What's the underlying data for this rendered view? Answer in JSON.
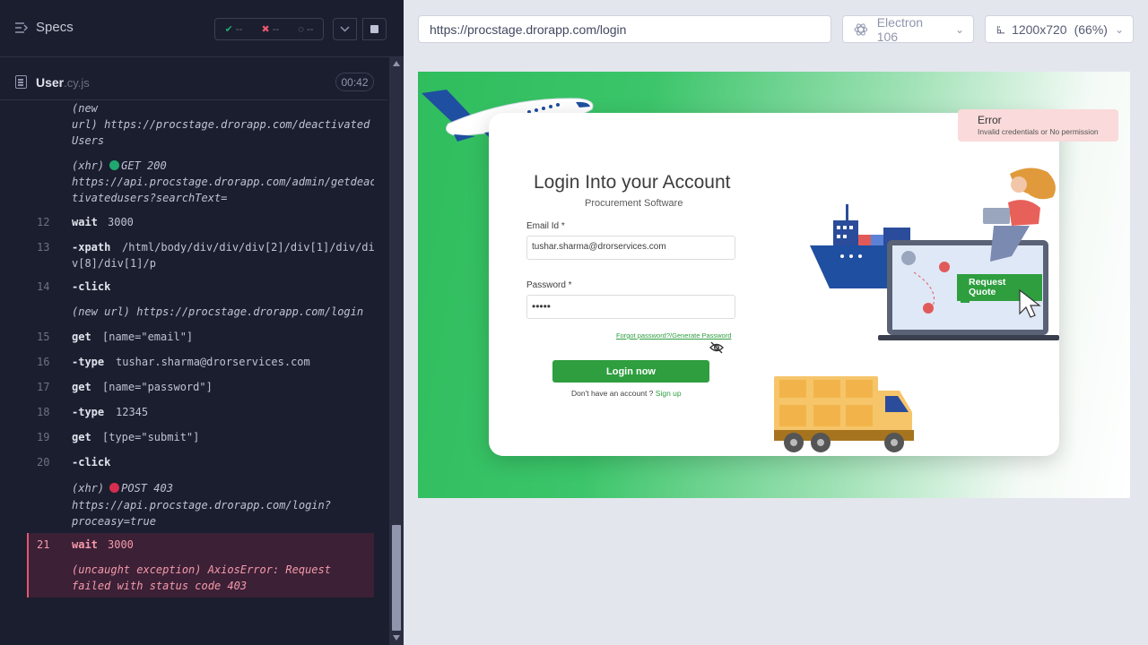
{
  "runner": {
    "specs_label": "Specs",
    "stats": {
      "passed": "--",
      "failed": "--",
      "pending": "--"
    },
    "file": {
      "name": "User",
      "ext": ".cy.js"
    },
    "timer": "00:42"
  },
  "log": {
    "r0a": "(new",
    "r0b": "url)  https://procstage.drorapp.com/deactivated",
    "r0c": "Users",
    "r1_prefix": "(xhr)",
    "r1_status": "GET 200",
    "r1b": "https://api.procstage.drorapp.com/admin/getdeac",
    "r1c": "tivatedusers?searchText=",
    "r12_num": "12",
    "r12_cmd": "wait",
    "r12_arg": "3000",
    "r13_num": "13",
    "r13_cmd": "-xpath",
    "r13_arg": "/html/body/div/div/div[2]/div[1]/div/di",
    "r13_arg2": "v[8]/div[1]/p",
    "r14_num": "14",
    "r14_cmd": "-click",
    "r14b": "(new url)  https://procstage.drorapp.com/login",
    "r15_num": "15",
    "r15_cmd": "get",
    "r15_arg": "[name=\"email\"]",
    "r16_num": "16",
    "r16_cmd": "-type",
    "r16_arg": "tushar.sharma@drorservices.com",
    "r17_num": "17",
    "r17_cmd": "get",
    "r17_arg": "[name=\"password\"]",
    "r18_num": "18",
    "r18_cmd": "-type",
    "r18_arg": "12345",
    "r19_num": "19",
    "r19_cmd": "get",
    "r19_arg": "[type=\"submit\"]",
    "r20_num": "20",
    "r20_cmd": "-click",
    "r20b_prefix": "(xhr)",
    "r20b_status": "POST 403",
    "r20c": "https://api.procstage.drorapp.com/login?",
    "r20d": "proceasy=true",
    "r21_num": "21",
    "r21_cmd": "wait",
    "r21_arg": "3000",
    "r21b": "(uncaught exception)  AxiosError: Request",
    "r21c": "failed with status code 403"
  },
  "toolbar": {
    "url": "https://procstage.drorapp.com/login",
    "browser": "Electron 106",
    "viewport": "1200x720",
    "zoom": "(66%)"
  },
  "app": {
    "title": "Login Into your Account",
    "subtitle": "Procurement Software",
    "email_label": "Email Id *",
    "email_value": "tushar.sharma@drorservices.com",
    "password_label": "Password *",
    "password_value": "•••••",
    "forgot": "Forgot password?/Generate Password",
    "login_button": "Login now",
    "no_account": "Don't have an account ? ",
    "signup": "Sign up",
    "request_quote_1": "Request",
    "request_quote_2": "Quote",
    "toast_title": "Error",
    "toast_message": "Invalid credentials or No permission"
  },
  "colors": {
    "pass": "#1fa971",
    "fail": "#e45770",
    "brand_green": "#2e9e3f"
  }
}
